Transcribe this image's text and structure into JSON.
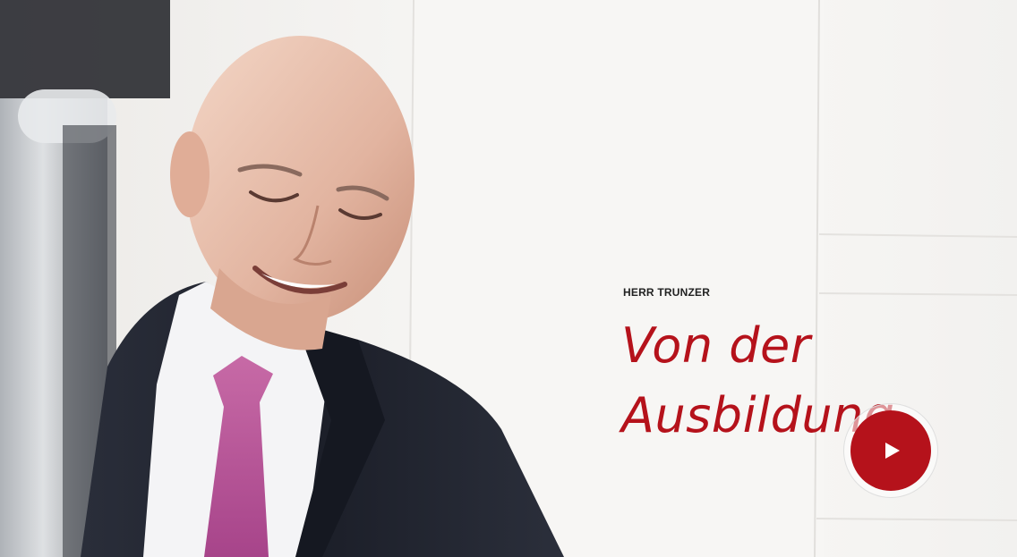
{
  "hero": {
    "eyebrow": "HERR TRUNZER",
    "headline_line1": "Von der",
    "headline_line2": "Ausbildung"
  },
  "play_button": {
    "icon": "play-icon"
  },
  "colors": {
    "accent": "#b5121b",
    "eyebrow_text": "#222222",
    "play_icon": "#ffffff"
  }
}
